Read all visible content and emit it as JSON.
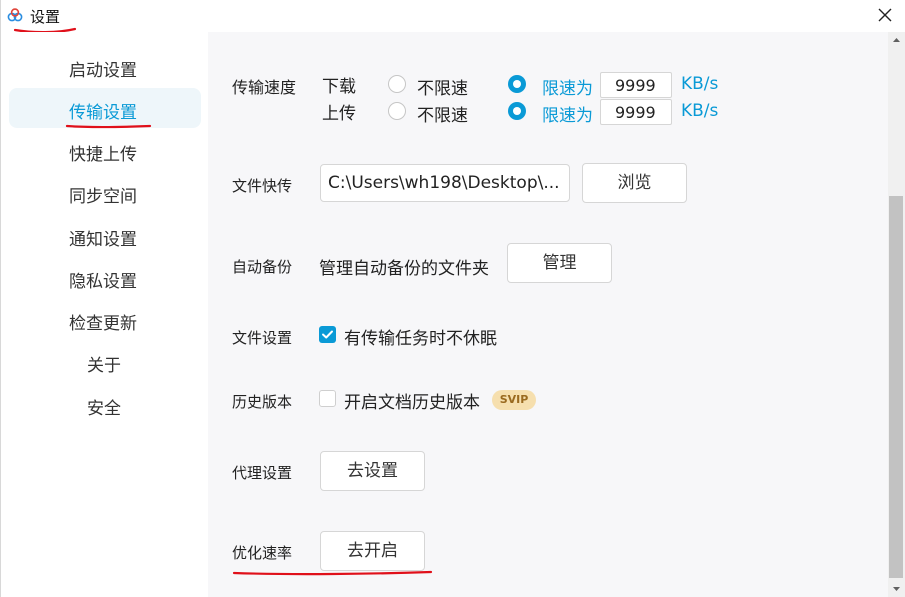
{
  "window": {
    "title": "设置",
    "icon": "baidu-netdisk-cloud-icon",
    "close_icon": "close-icon"
  },
  "sidebar": {
    "items": [
      {
        "label": "启动设置",
        "active": false
      },
      {
        "label": "传输设置",
        "active": true
      },
      {
        "label": "快捷上传",
        "active": false
      },
      {
        "label": "同步空间",
        "active": false
      },
      {
        "label": "通知设置",
        "active": false
      },
      {
        "label": "隐私设置",
        "active": false
      },
      {
        "label": "检查更新",
        "active": false
      },
      {
        "label": "关于",
        "active": false
      },
      {
        "label": "安全",
        "active": false
      }
    ]
  },
  "transfer_speed": {
    "label": "传输速度",
    "download": {
      "label": "下载",
      "unlimited_label": "不限速",
      "limit_label": "限速为",
      "value": "9999",
      "unit": "KB/s",
      "selected": "limit"
    },
    "upload": {
      "label": "上传",
      "unlimited_label": "不限速",
      "limit_label": "限速为",
      "value": "9999",
      "unit": "KB/s",
      "selected": "limit"
    }
  },
  "quick_transfer": {
    "label": "文件快传",
    "path": "C:\\Users\\wh198\\Desktop\\...",
    "browse_label": "浏览"
  },
  "auto_backup": {
    "label": "自动备份",
    "description": "管理自动备份的文件夹",
    "manage_label": "管理"
  },
  "file_settings": {
    "label": "文件设置",
    "option_label": "有传输任务时不休眠",
    "checked": true
  },
  "history_version": {
    "label": "历史版本",
    "option_label": "开启文档历史版本",
    "checked": false,
    "badge": "SVIP"
  },
  "proxy": {
    "label": "代理设置",
    "button_label": "去设置"
  },
  "optimize_rate": {
    "label": "优化速率",
    "button_label": "去开启"
  },
  "colors": {
    "accent": "#0a9ad6",
    "annotation": "#e0101a",
    "svip_bg": "#f6dfae"
  }
}
